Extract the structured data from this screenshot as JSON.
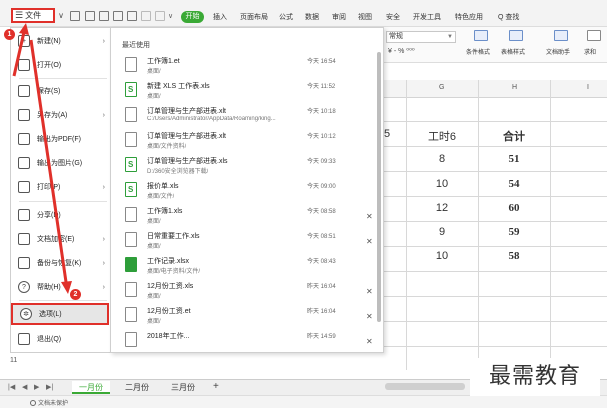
{
  "menubar": {
    "file_label": "文件",
    "start_label": "开始",
    "tabs": [
      "插入",
      "页面布局",
      "公式",
      "数据",
      "审阅",
      "视图",
      "安全",
      "开发工具",
      "特色应用"
    ],
    "search_label": "Q 查找",
    "accent": "#3aa935"
  },
  "ribbon": {
    "number_format": "常规",
    "conditional_format": "条件格式",
    "table_style": "表格样式",
    "doc_helper": "文档助手",
    "sum": "求和"
  },
  "file_menu": {
    "items": [
      {
        "label": "新建(N)",
        "icon": "new-icon",
        "arrow": true
      },
      {
        "label": "打开(O)",
        "icon": "open-folder-icon",
        "arrow": false
      },
      {
        "label": "保存(S)",
        "icon": "save-icon",
        "arrow": false
      },
      {
        "label": "另存为(A)",
        "icon": "save-as-icon",
        "arrow": true
      },
      {
        "label": "输出为PDF(F)",
        "icon": "pdf-icon",
        "arrow": false
      },
      {
        "label": "输出为图片(G)",
        "icon": "image-icon",
        "arrow": false
      },
      {
        "label": "打印(P)",
        "icon": "print-icon",
        "arrow": true
      },
      {
        "label": "分享(D)",
        "icon": "share-icon",
        "arrow": false
      },
      {
        "label": "文档加密(E)",
        "icon": "encrypt-icon",
        "arrow": true
      },
      {
        "label": "备份与恢复(K)",
        "icon": "backup-icon",
        "arrow": true
      },
      {
        "label": "帮助(H)",
        "icon": "help-icon",
        "arrow": true
      },
      {
        "label": "选项(L)",
        "icon": "gear-icon",
        "arrow": false
      },
      {
        "label": "退出(Q)",
        "icon": "exit-icon",
        "arrow": false
      }
    ]
  },
  "recent": {
    "title": "最近使用",
    "files": [
      {
        "name": "工作簿1.et",
        "path": "桌面/",
        "time": "今天 16:54",
        "icon": "gray",
        "close": false
      },
      {
        "name": "新建 XLS 工作表.xls",
        "path": "桌面/",
        "time": "今天 11:52",
        "icon": "green",
        "close": false
      },
      {
        "name": "订单管理与生产部进表.xlt",
        "path": "C:/Users/Administrator/AppData/Roaming/king...",
        "time": "今天 10:18",
        "icon": "gray",
        "close": false
      },
      {
        "name": "订单管理与生产部进表.xlt",
        "path": "桌面/文件资料/",
        "time": "今天 10:12",
        "icon": "gray",
        "close": false
      },
      {
        "name": "订单管理与生产部进表.xls",
        "path": "D:/360安全浏览器下载/",
        "time": "今天 09:33",
        "icon": "green",
        "close": false
      },
      {
        "name": "报价单.xls",
        "path": "桌面/文件/",
        "time": "今天 09:00",
        "icon": "green",
        "close": false
      },
      {
        "name": "工作簿1.xls",
        "path": "桌面/",
        "time": "今天 08:58",
        "icon": "gray",
        "close": true
      },
      {
        "name": "日常重要工作.xls",
        "path": "桌面/",
        "time": "今天 08:51",
        "icon": "gray",
        "close": true
      },
      {
        "name": "工作记录.xlsx",
        "path": "桌面/电子资料/文件/",
        "time": "今天 08:43",
        "icon": "solid",
        "close": false
      },
      {
        "name": "12月份工资.xls",
        "path": "桌面/",
        "time": "昨天 16:04",
        "icon": "gray",
        "close": true
      },
      {
        "name": "12月份工资.et",
        "path": "桌面/",
        "time": "昨天 16:04",
        "icon": "gray",
        "close": true
      },
      {
        "name": "2018年工作...",
        "path": "",
        "time": "昨天 14:59",
        "icon": "gray",
        "close": true
      }
    ]
  },
  "sheet": {
    "columns": [
      "G",
      "H",
      "I"
    ],
    "partial_header": "5",
    "header_g": "工时6",
    "header_h": "合计",
    "rows": [
      {
        "g": "8",
        "h": "51"
      },
      {
        "g": "10",
        "h": "54"
      },
      {
        "g": "12",
        "h": "60"
      },
      {
        "g": "9",
        "h": "59"
      },
      {
        "g": "10",
        "h": "58"
      }
    ],
    "row_11": "11"
  },
  "tabs": {
    "sheets": [
      "一月份",
      "二月份",
      "三月份"
    ],
    "add": "+"
  },
  "status": {
    "doc_status": "文档未保护"
  },
  "annotations": {
    "badge_1": "1",
    "badge_2": "2",
    "red": "#e0302a"
  },
  "watermark": "最需教育"
}
